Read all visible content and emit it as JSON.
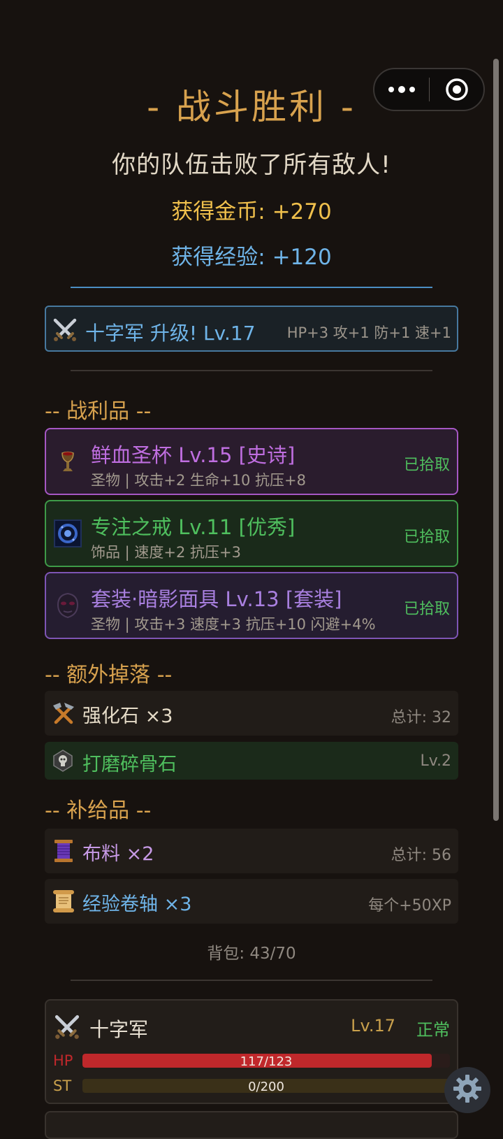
{
  "header": {
    "title": "- 战斗胜利 -",
    "subtitle": "你的队伍击败了所有敌人!",
    "gold": "获得金币: +270",
    "xp": "获得经验: +120"
  },
  "levelup": {
    "name": "十字军 升级! Lv.17",
    "stats": "HP+3 攻+1 防+1 速+1",
    "icon": "crossed-swords-icon"
  },
  "loot": {
    "heading": "-- 战利品 --",
    "items": [
      {
        "name": "鲜血圣杯 Lv.15 [史诗]",
        "desc": "圣物 | 攻击+2 生命+10 抗压+8",
        "status": "已拾取",
        "icon": "blood-chalice-icon",
        "rarity_color": "#a657c4"
      },
      {
        "name": "专注之戒 Lv.11 [优秀]",
        "desc": "饰品 | 速度+2 抗压+3",
        "status": "已拾取",
        "icon": "focus-ring-icon",
        "rarity_color": "#3e9a48"
      },
      {
        "name": "套装·暗影面具 Lv.13 [套装]",
        "desc": "圣物 | 攻击+3 速度+3 抗压+10 闪避+4%",
        "status": "已拾取",
        "icon": "shadow-mask-icon",
        "rarity_color": "#7e55b5"
      }
    ]
  },
  "extra": {
    "heading": "-- 额外掉落 --",
    "items": [
      {
        "name": "强化石 ×3",
        "extra": "总计: 32",
        "icon": "hammer-pick-icon"
      },
      {
        "name": "打磨碎骨石",
        "extra": "Lv.2",
        "icon": "bone-stone-icon"
      }
    ]
  },
  "supplies": {
    "heading": "-- 补给品 --",
    "items": [
      {
        "name": "布料 ×2",
        "extra": "总计: 56",
        "icon": "thread-spool-icon"
      },
      {
        "name": "经验卷轴 ×3",
        "extra": "每个+50XP",
        "icon": "scroll-icon"
      }
    ]
  },
  "bag": "背包: 43/70",
  "party": {
    "name": "十字军",
    "level": "Lv.17",
    "status": "正常",
    "hp_label": "HP",
    "hp_text": "117/123",
    "hp_fraction": 0.951,
    "st_label": "ST",
    "st_text": "0/200",
    "st_fraction": 0.0
  },
  "colors": {
    "gold": "#f0c04c",
    "xp": "#6fb4e8",
    "epic": "#bf6ee0",
    "good": "#4fbf5e",
    "set": "#a980e0",
    "hp_bar": "#c0282b",
    "st_bar": "#3a3018"
  }
}
